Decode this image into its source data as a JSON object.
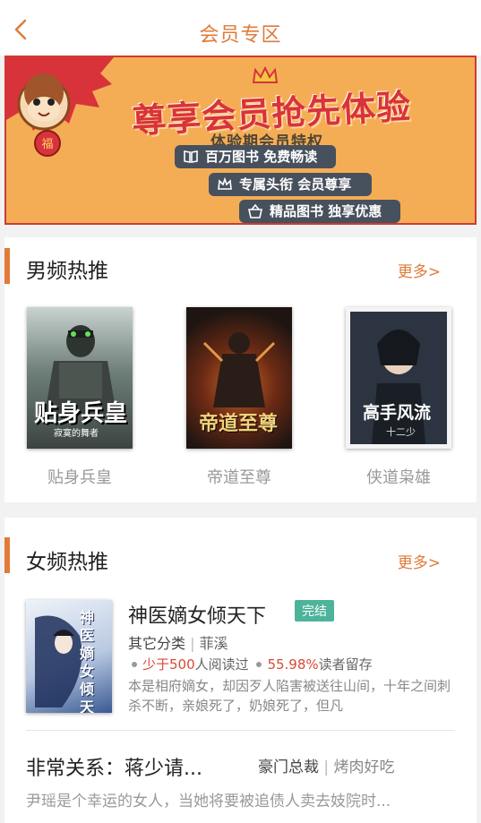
{
  "header": {
    "title": "会员专区"
  },
  "banner": {
    "title": "尊享会员抢先体验",
    "subtitle": "体验期会员特权",
    "perks": [
      "百万图书  免费畅读",
      "专属头衔  会员尊享",
      "精品图书  独享优惠"
    ]
  },
  "male": {
    "title": "男频热推",
    "more": "更多>",
    "books": [
      {
        "name": "贴身兵皇",
        "cover_text": "贴身兵皇",
        "cover_author": "寂寞的舞者"
      },
      {
        "name": "帝道至尊",
        "cover_text": "帝道至尊",
        "cover_author": ""
      },
      {
        "name": "侠道枭雄",
        "cover_text": "高手风流",
        "cover_author": "十二少"
      }
    ]
  },
  "female": {
    "title": "女频热推",
    "more": "更多>",
    "featured": {
      "title": "神医嫡女倾天下",
      "status": "完结",
      "category": "其它分类",
      "author": "菲溪",
      "readers": "少于500",
      "readers_suffix": "人阅读过",
      "retention": "55.98%",
      "retention_suffix": "读者留存",
      "description": "本是相府嫡女，却因歹人陷害被送往山间，十年之间刺杀不断，亲娘死了，奶娘死了，但凡",
      "cover_text": "神医嫡女倾天下"
    },
    "item2": {
      "title": "非常关系：蒋少请...",
      "category": "豪门总裁",
      "author": "烤肉好吃",
      "description": "尹瑶是个幸运的女人，当她将要被追债人卖去妓院时..."
    }
  }
}
